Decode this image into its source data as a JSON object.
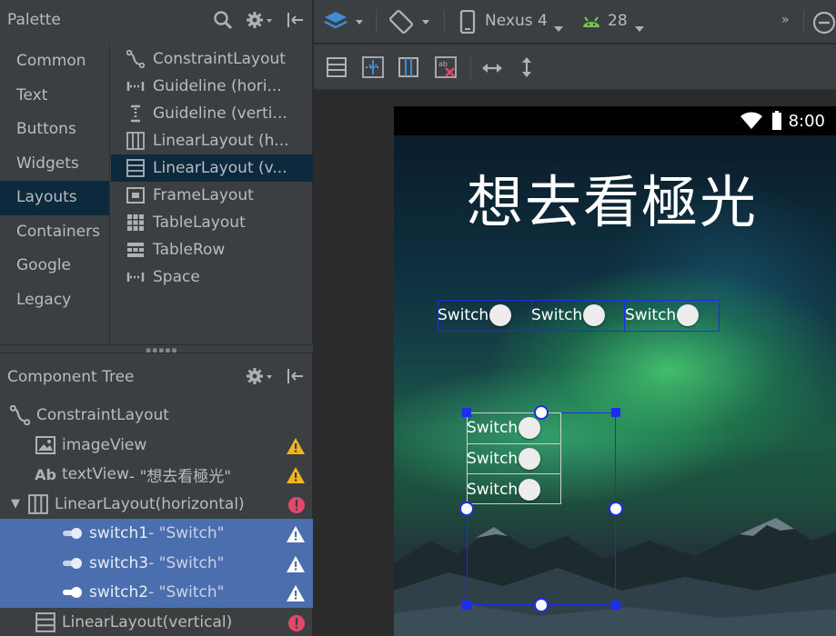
{
  "palette": {
    "title": "Palette",
    "categories": [
      {
        "label": "Common"
      },
      {
        "label": "Text"
      },
      {
        "label": "Buttons"
      },
      {
        "label": "Widgets"
      },
      {
        "label": "Layouts"
      },
      {
        "label": "Containers"
      },
      {
        "label": "Google"
      },
      {
        "label": "Legacy"
      }
    ],
    "selected_category": "Layouts",
    "items": [
      {
        "label": "ConstraintLayout",
        "icon": "constraint-layout-icon"
      },
      {
        "label": "Guideline (hori...",
        "icon": "guideline-horizontal-icon"
      },
      {
        "label": "Guideline (verti...",
        "icon": "guideline-vertical-icon"
      },
      {
        "label": "LinearLayout (h...",
        "icon": "linear-layout-horizontal-icon"
      },
      {
        "label": "LinearLayout (v...",
        "icon": "linear-layout-vertical-icon"
      },
      {
        "label": "FrameLayout",
        "icon": "frame-layout-icon"
      },
      {
        "label": "TableLayout",
        "icon": "table-layout-icon"
      },
      {
        "label": "TableRow",
        "icon": "table-row-icon"
      },
      {
        "label": "Space",
        "icon": "space-icon"
      }
    ]
  },
  "tree": {
    "title": "Component Tree",
    "rows": [
      {
        "name": "ConstraintLayout",
        "sub": ""
      },
      {
        "name": "imageView",
        "sub": ""
      },
      {
        "name": "textView",
        "sub": "- \"想去看極光\""
      },
      {
        "name": "LinearLayout",
        "sub": "(horizontal)"
      },
      {
        "name": "switch1",
        "sub": "- \"Switch\""
      },
      {
        "name": "switch3",
        "sub": "- \"Switch\""
      },
      {
        "name": "switch2",
        "sub": "- \"Switch\""
      },
      {
        "name": "LinearLayout",
        "sub": "(vertical)"
      }
    ]
  },
  "toolbar": {
    "device": "Nexus 4",
    "api": "28"
  },
  "preview": {
    "time": "8:00",
    "title": "想去看極光",
    "switch_label": "Switch"
  },
  "colors": {
    "selection": "#4b6eaf",
    "palette_selection": "#0d293e",
    "warning": "#f0b420",
    "error": "#e5476a",
    "blueprint": "#1e2cf0"
  }
}
